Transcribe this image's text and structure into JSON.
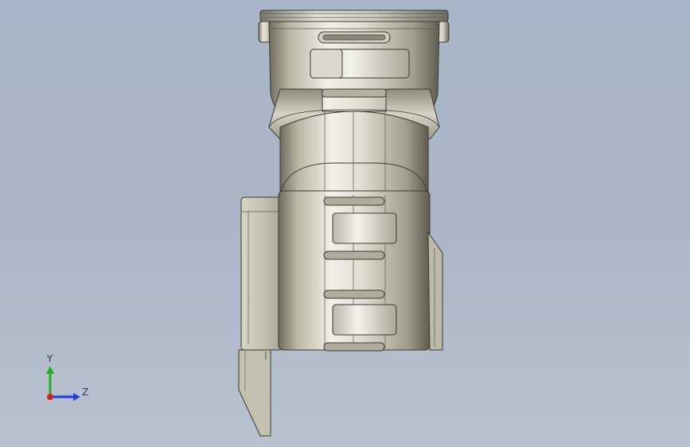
{
  "viewport": {
    "background_top": "#a9b6c9",
    "background_bottom": "#b9c2cf",
    "model_shade": "#c9c5b3",
    "model_edge": "#3a3a32"
  },
  "triad": {
    "y_label": "Y",
    "z_label": "Z",
    "y_color": "#1fb31f",
    "z_color": "#1f3fd9",
    "x_color": "#d91f1f"
  }
}
